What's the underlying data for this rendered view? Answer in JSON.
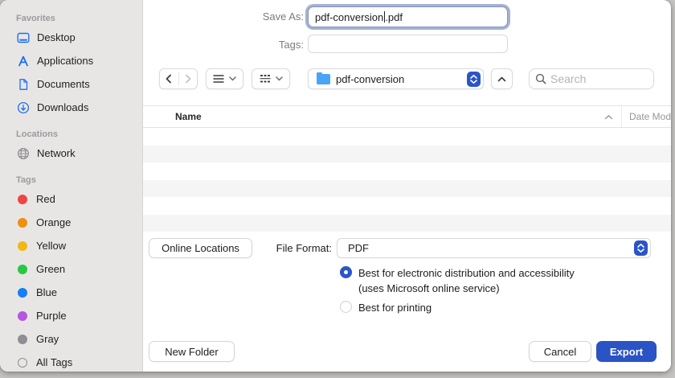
{
  "save_as": {
    "label": "Save As:",
    "value_before_caret": "pdf-conversion",
    "value_after_caret": ".pdf"
  },
  "tags_field": {
    "label": "Tags:",
    "value": ""
  },
  "toolbar": {
    "folder_dropdown_value": "pdf-conversion",
    "search_placeholder": "Search"
  },
  "sidebar": {
    "sections": [
      {
        "title": "Favorites",
        "items": [
          {
            "label": "Desktop",
            "icon": "desktop-icon"
          },
          {
            "label": "Applications",
            "icon": "applications-icon"
          },
          {
            "label": "Documents",
            "icon": "document-icon"
          },
          {
            "label": "Downloads",
            "icon": "downloads-icon"
          }
        ]
      },
      {
        "title": "Locations",
        "items": [
          {
            "label": "Network",
            "icon": "globe-icon"
          }
        ]
      },
      {
        "title": "Tags",
        "items": [
          {
            "label": "Red",
            "color": "#ec4740"
          },
          {
            "label": "Orange",
            "color": "#ef8f0e"
          },
          {
            "label": "Yellow",
            "color": "#efb913"
          },
          {
            "label": "Green",
            "color": "#28c840"
          },
          {
            "label": "Blue",
            "color": "#157ff6"
          },
          {
            "label": "Purple",
            "color": "#b556de"
          },
          {
            "label": "Gray",
            "color": "#8e8e93"
          },
          {
            "label": "All Tags",
            "color": "outline"
          }
        ]
      }
    ]
  },
  "file_list": {
    "columns": [
      "Name",
      "Date Mod"
    ],
    "sort": "ascending",
    "rows": []
  },
  "format_section": {
    "online_locations_label": "Online Locations",
    "file_format_label": "File Format:",
    "file_format_value": "PDF",
    "options": [
      {
        "label": "Best for electronic distribution and accessibility",
        "sublabel": "(uses Microsoft online service)",
        "selected": true
      },
      {
        "label": "Best for printing",
        "sublabel": "",
        "selected": false
      }
    ]
  },
  "footer": {
    "new_folder_label": "New Folder",
    "cancel_label": "Cancel",
    "export_label": "Export"
  },
  "colors": {
    "accent_blue": "#2a55c8",
    "export_button_blue": "#2a53c5",
    "folder_icon_blue": "#4aa3f7",
    "sidebar_icon_blue": "#1f6ef0",
    "sidebar_bg": "#e8e6e5",
    "row_stripe": "#f5f5f6"
  }
}
